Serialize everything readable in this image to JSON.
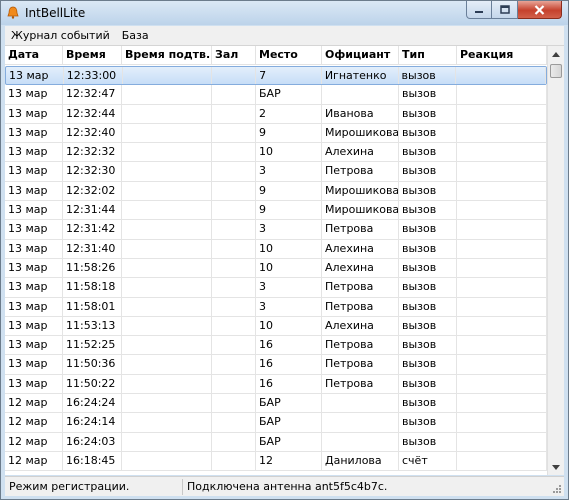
{
  "window": {
    "title": "IntBellLite"
  },
  "menu": [
    "Журнал событий",
    "База"
  ],
  "columns": [
    "Дата",
    "Время",
    "Время подтв.",
    "Зал",
    "Место",
    "Официант",
    "Тип",
    "Реакция"
  ],
  "rows": [
    {
      "date": "13 мар",
      "time": "12:33:00",
      "confirm": "",
      "hall": "",
      "place": "7",
      "waiter": "Игнатенко",
      "type": "вызов",
      "reaction": "",
      "selected": true
    },
    {
      "date": "13 мар",
      "time": "12:32:47",
      "confirm": "",
      "hall": "",
      "place": "БАР",
      "waiter": "",
      "type": "вызов",
      "reaction": ""
    },
    {
      "date": "13 мар",
      "time": "12:32:44",
      "confirm": "",
      "hall": "",
      "place": "2",
      "waiter": "Иванова",
      "type": "вызов",
      "reaction": ""
    },
    {
      "date": "13 мар",
      "time": "12:32:40",
      "confirm": "",
      "hall": "",
      "place": "9",
      "waiter": "Мирошикова",
      "type": "вызов",
      "reaction": ""
    },
    {
      "date": "13 мар",
      "time": "12:32:32",
      "confirm": "",
      "hall": "",
      "place": "10",
      "waiter": "Алехина",
      "type": "вызов",
      "reaction": ""
    },
    {
      "date": "13 мар",
      "time": "12:32:30",
      "confirm": "",
      "hall": "",
      "place": "3",
      "waiter": "Петрова",
      "type": "вызов",
      "reaction": ""
    },
    {
      "date": "13 мар",
      "time": "12:32:02",
      "confirm": "",
      "hall": "",
      "place": "9",
      "waiter": "Мирошикова",
      "type": "вызов",
      "reaction": ""
    },
    {
      "date": "13 мар",
      "time": "12:31:44",
      "confirm": "",
      "hall": "",
      "place": "9",
      "waiter": "Мирошикова",
      "type": "вызов",
      "reaction": ""
    },
    {
      "date": "13 мар",
      "time": "12:31:42",
      "confirm": "",
      "hall": "",
      "place": "3",
      "waiter": "Петрова",
      "type": "вызов",
      "reaction": ""
    },
    {
      "date": "13 мар",
      "time": "12:31:40",
      "confirm": "",
      "hall": "",
      "place": "10",
      "waiter": "Алехина",
      "type": "вызов",
      "reaction": ""
    },
    {
      "date": "13 мар",
      "time": "11:58:26",
      "confirm": "",
      "hall": "",
      "place": "10",
      "waiter": "Алехина",
      "type": "вызов",
      "reaction": ""
    },
    {
      "date": "13 мар",
      "time": "11:58:18",
      "confirm": "",
      "hall": "",
      "place": "3",
      "waiter": "Петрова",
      "type": "вызов",
      "reaction": ""
    },
    {
      "date": "13 мар",
      "time": "11:58:01",
      "confirm": "",
      "hall": "",
      "place": "3",
      "waiter": "Петрова",
      "type": "вызов",
      "reaction": ""
    },
    {
      "date": "13 мар",
      "time": "11:53:13",
      "confirm": "",
      "hall": "",
      "place": "10",
      "waiter": "Алехина",
      "type": "вызов",
      "reaction": ""
    },
    {
      "date": "13 мар",
      "time": "11:52:25",
      "confirm": "",
      "hall": "",
      "place": "16",
      "waiter": "Петрова",
      "type": "вызов",
      "reaction": ""
    },
    {
      "date": "13 мар",
      "time": "11:50:36",
      "confirm": "",
      "hall": "",
      "place": "16",
      "waiter": "Петрова",
      "type": "вызов",
      "reaction": ""
    },
    {
      "date": "13 мар",
      "time": "11:50:22",
      "confirm": "",
      "hall": "",
      "place": "16",
      "waiter": "Петрова",
      "type": "вызов",
      "reaction": ""
    },
    {
      "date": "12 мар",
      "time": "16:24:24",
      "confirm": "",
      "hall": "",
      "place": "БАР",
      "waiter": "",
      "type": "вызов",
      "reaction": ""
    },
    {
      "date": "12 мар",
      "time": "16:24:14",
      "confirm": "",
      "hall": "",
      "place": "БАР",
      "waiter": "",
      "type": "вызов",
      "reaction": ""
    },
    {
      "date": "12 мар",
      "time": "16:24:03",
      "confirm": "",
      "hall": "",
      "place": "БАР",
      "waiter": "",
      "type": "вызов",
      "reaction": ""
    },
    {
      "date": "12 мар",
      "time": "16:18:45",
      "confirm": "",
      "hall": "",
      "place": "12",
      "waiter": "Данилова",
      "type": "счёт",
      "reaction": ""
    }
  ],
  "status": {
    "mode": "Режим регистрации.",
    "antenna": "Подключена антенна ant5f5c4b7c."
  },
  "colors": {
    "selection": "#cfe3f8",
    "selection_border": "#84acdd",
    "close_button": "#c5412d"
  },
  "icons": {
    "app": "bell-icon",
    "minimize": "minimize-icon",
    "maximize": "maximize-icon",
    "close": "close-icon",
    "scroll_up": "arrow-up-icon",
    "scroll_down": "arrow-down-icon",
    "grip": "resize-grip-icon"
  }
}
